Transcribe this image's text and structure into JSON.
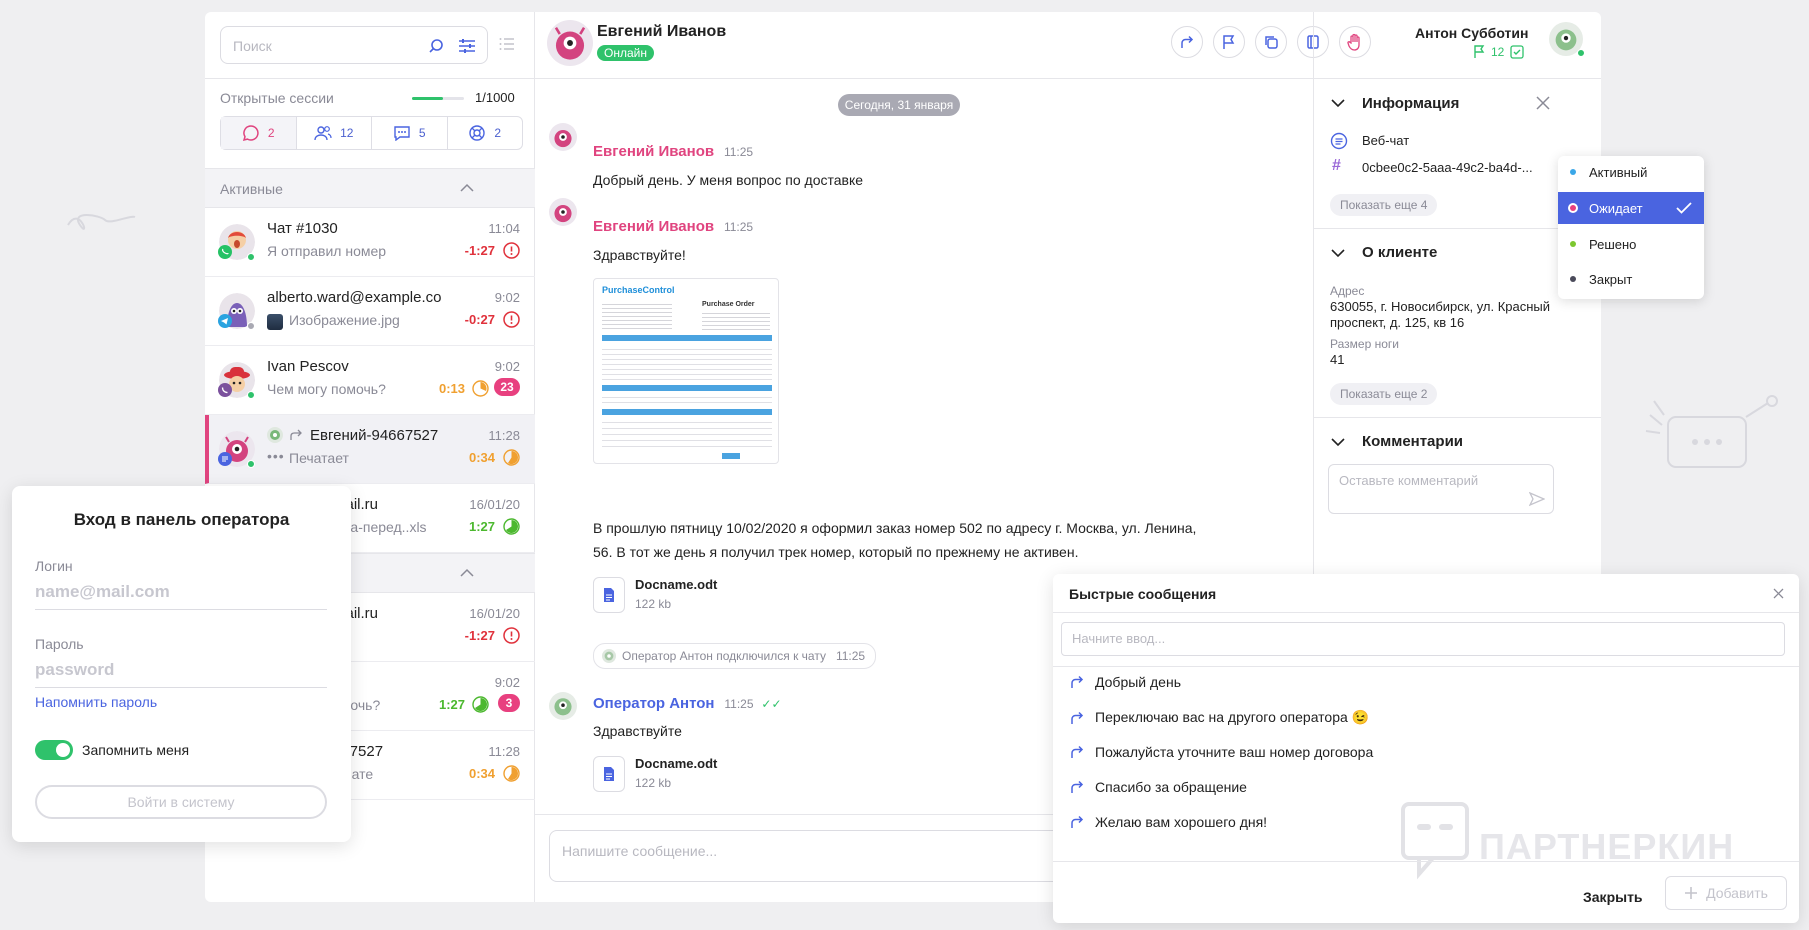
{
  "search": {
    "placeholder": "Поиск"
  },
  "sessions": {
    "label": "Открытые сессии",
    "count": "1/1000",
    "progress": 0.6
  },
  "session_tabs": [
    {
      "icon": "chat-bubble-icon",
      "count": "2"
    },
    {
      "icon": "users-icon",
      "count": "12"
    },
    {
      "icon": "message-dots-icon",
      "count": "5"
    },
    {
      "icon": "lifebuoy-icon",
      "count": "2"
    }
  ],
  "sections": {
    "active": "Активные"
  },
  "chats": [
    {
      "name": "Чат #1030",
      "time": "11:04",
      "message": "Я отправил номер",
      "timer": "-1:27",
      "timer_color": "#e0323c",
      "channel": "whatsapp"
    },
    {
      "name": "alberto.ward@example.co",
      "time": "9:02",
      "message": "Изображение.jpg",
      "timer": "-0:27",
      "timer_color": "#e0323c",
      "channel": "telegram"
    },
    {
      "name": "Ivan Pescov",
      "time": "9:02",
      "message": "Чем могу помочь?",
      "timer": "0:13",
      "timer_color": "#f0a030",
      "badge": "23",
      "channel": "viber"
    },
    {
      "name": "Евгений-94667527",
      "time": "11:28",
      "message": "Печатает",
      "timer": "0:34",
      "timer_color": "#f0a030",
      "channel": "webchat"
    },
    {
      "name": "mail.ru",
      "time": "16/01/20",
      "message": "ема-перед..xls",
      "timer": "1:27",
      "timer_color": "#4cb82f"
    },
    {
      "name": "mail.ru",
      "time": "16/01/20",
      "message": "",
      "timer": "-1:27",
      "timer_color": "#e0323c"
    },
    {
      "name": "",
      "time": "9:02",
      "message": "омочь?",
      "timer": "1:27",
      "timer_color": "#4cb82f",
      "badge": "3"
    },
    {
      "name": "667527",
      "time": "11:28",
      "message": "в чате",
      "timer": "0:34",
      "timer_color": "#f0a030"
    }
  ],
  "header": {
    "contact_name": "Евгений Иванов",
    "status": "Онлайн",
    "operator_name": "Антон Субботин",
    "operator_flags": "12",
    "actions": [
      "forward-icon",
      "flag-icon",
      "copy-icon",
      "book-icon",
      "hand-icon"
    ]
  },
  "conversation": {
    "date": "Сегодня, 31 января",
    "messages": [
      {
        "author": "Евгений Иванов",
        "time": "11:25",
        "text": "Добрый день. У меня вопрос по доставке"
      },
      {
        "author": "Евгений Иванов",
        "time": "11:25",
        "text": "Здравствуйте!"
      },
      {
        "text": "В прошлую пятницу 10/02/2020 я оформил заказ номер 502 по адресу г. Москва, ул. Ленина, 56. В тот же день я получил трек номер, который по прежнему не активен."
      },
      {
        "author": "Оператор Антон",
        "time": "11:25",
        "text": "Здравствуйте"
      }
    ],
    "attachment_doc": {
      "brand": "PurchaseControl",
      "title": "Purchase Order"
    },
    "files": [
      {
        "name": "Docname.odt",
        "size": "122 kb"
      },
      {
        "name": "Docname.odt",
        "size": "122 kb"
      }
    ],
    "system": {
      "text": "Оператор Антон подключился к чату",
      "time": "11:25"
    },
    "composer_placeholder": "Напишите сообщение..."
  },
  "info": {
    "title": "Информация",
    "channel": "Веб-чат",
    "id": "0cbee0c2-5aaa-49c2-ba4d-...",
    "show_more_1": "Показать еще 4",
    "client_title": "О клиенте",
    "address_label": "Адрес",
    "address": "630055, г. Новосибирск, ул. Красный проспект, д. 125, кв 16",
    "shoe_label": "Размер ноги",
    "shoe": "41",
    "show_more_2": "Показать еще 2",
    "comments_title": "Комментарии",
    "comment_placeholder": "Оставьте комментарий"
  },
  "status_dropdown": [
    {
      "label": "Активный",
      "color": "#3aa7e8"
    },
    {
      "label": "Ожидает",
      "color": "#e8407f",
      "selected": true
    },
    {
      "label": "Решено",
      "color": "#7cc72f"
    },
    {
      "label": "Закрыт",
      "color": "#4a4a5a"
    }
  ],
  "login": {
    "title": "Вход в панель оператора",
    "login_label": "Логин",
    "login_placeholder": "name@mail.com",
    "password_label": "Пароль",
    "password_placeholder": "password",
    "remind": "Напомнить пароль",
    "remember": "Запомнить меня",
    "submit": "Войти в систему"
  },
  "quick_messages": {
    "title": "Быстрые сообщения",
    "placeholder": "Начните ввод...",
    "items": [
      "Добрый день",
      "Переключаю вас на другого оператора 😉",
      "Пожалуйста уточните ваш номер договора",
      "Спасибо за обращение",
      "Желаю вам хорошего дня!"
    ],
    "close": "Закрыть",
    "add": "Добавить"
  },
  "watermark": "ПАРТНЕРКИН",
  "colors": {
    "accent_pink": "#e0447f",
    "accent_blue": "#4a64e0",
    "online_green": "#2fc26b"
  }
}
